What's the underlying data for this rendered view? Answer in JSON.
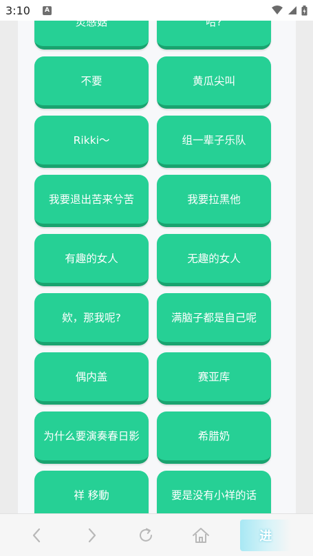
{
  "status_bar": {
    "time": "3:10",
    "app_icon_letter": "A",
    "icons": [
      "wifi-icon",
      "signal-icon",
      "battery-icon"
    ]
  },
  "sound_buttons": [
    {
      "label": "灵感菇"
    },
    {
      "label": "哈?"
    },
    {
      "label": "不要"
    },
    {
      "label": "黄瓜尖叫"
    },
    {
      "label": "Rikki～"
    },
    {
      "label": "组一辈子乐队"
    },
    {
      "label": "我要退出苦来兮苦"
    },
    {
      "label": "我要拉黑他"
    },
    {
      "label": "有趣的女人"
    },
    {
      "label": "无趣的女人"
    },
    {
      "label": "欸，那我呢?"
    },
    {
      "label": "满脑子都是自己呢"
    },
    {
      "label": "偶内盖"
    },
    {
      "label": "赛亚库"
    },
    {
      "label": "为什么要演奏春日影"
    },
    {
      "label": "希腊奶"
    },
    {
      "label": "祥 移動"
    },
    {
      "label": "要是没有小祥的话"
    }
  ],
  "nav_bar": {
    "back_icon": "chevron-left-icon",
    "forward_icon": "chevron-right-icon",
    "refresh_icon": "refresh-icon",
    "home_icon": "home-icon",
    "ad_text": "进"
  },
  "colors": {
    "button_bg": "#26d095",
    "button_shadow": "#1aa36f",
    "panel_bg": "#f7f8fa",
    "nav_icon": "#b8b8b8"
  }
}
